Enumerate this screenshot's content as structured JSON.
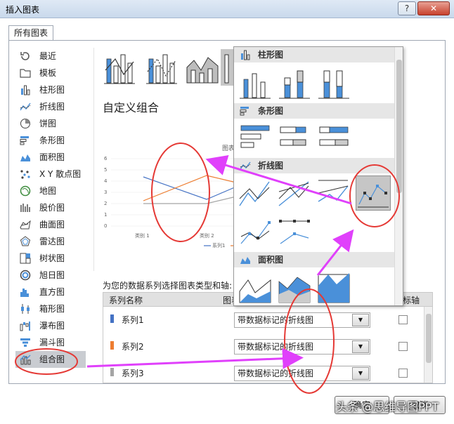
{
  "window": {
    "title": "插入图表",
    "help_label": "?",
    "close_label": "✕"
  },
  "tabs": [
    {
      "label": "所有图表"
    }
  ],
  "sidebar": {
    "items": [
      {
        "label": "最近",
        "icon": "recent-icon"
      },
      {
        "label": "模板",
        "icon": "folder-icon"
      },
      {
        "label": "柱形图",
        "icon": "column-chart-icon"
      },
      {
        "label": "折线图",
        "icon": "line-chart-icon"
      },
      {
        "label": "饼图",
        "icon": "pie-chart-icon"
      },
      {
        "label": "条形图",
        "icon": "bar-chart-icon"
      },
      {
        "label": "面积图",
        "icon": "area-chart-icon"
      },
      {
        "label": "X Y 散点图",
        "icon": "scatter-chart-icon"
      },
      {
        "label": "地图",
        "icon": "map-chart-icon"
      },
      {
        "label": "股价图",
        "icon": "stock-chart-icon"
      },
      {
        "label": "曲面图",
        "icon": "surface-chart-icon"
      },
      {
        "label": "雷达图",
        "icon": "radar-chart-icon"
      },
      {
        "label": "树状图",
        "icon": "treemap-chart-icon"
      },
      {
        "label": "旭日图",
        "icon": "sunburst-chart-icon"
      },
      {
        "label": "直方图",
        "icon": "histogram-chart-icon"
      },
      {
        "label": "箱形图",
        "icon": "boxplot-chart-icon"
      },
      {
        "label": "瀑布图",
        "icon": "waterfall-chart-icon"
      },
      {
        "label": "漏斗图",
        "icon": "funnel-chart-icon"
      },
      {
        "label": "组合图",
        "icon": "combo-chart-icon",
        "selected": true
      }
    ]
  },
  "main": {
    "heading": "自定义组合",
    "preview": {
      "title_fragment": "图表",
      "y_ticks": [
        "6",
        "5",
        "4",
        "3",
        "2",
        "1",
        "0"
      ],
      "categories": [
        "类别 1",
        "类别 2"
      ],
      "legend": [
        "系列1"
      ]
    },
    "series_label": "为您的数据系列选择图表类型和轴:",
    "grid": {
      "col_name": "系列名称",
      "col_type": "图表",
      "col_axis": "标轴",
      "rows": [
        {
          "name": "系列1",
          "color": "#4472c4",
          "type": "带数据标记的折线图"
        },
        {
          "name": "系列2",
          "color": "#ed7d31",
          "type": "带数据标记的折线图"
        },
        {
          "name": "系列3",
          "color": "#a5a5a5",
          "type": "带数据标记的折线图"
        }
      ]
    }
  },
  "popup": {
    "categories": [
      {
        "label": "柱形图",
        "icon": "column-chart-icon"
      },
      {
        "label": "条形图",
        "icon": "bar-chart-icon"
      },
      {
        "label": "折线图",
        "icon": "line-chart-icon"
      },
      {
        "label": "面积图",
        "icon": "area-chart-icon"
      }
    ]
  },
  "buttons": {
    "ok": "确定",
    "cancel": "取消"
  },
  "watermark": "头条 @思维导图PPT",
  "colors": {
    "accent_blue": "#4472c4",
    "accent_orange": "#ed7d31",
    "accent_gray": "#a5a5a5",
    "annotation_magenta": "#e040fb",
    "annotation_red": "#e53935"
  }
}
